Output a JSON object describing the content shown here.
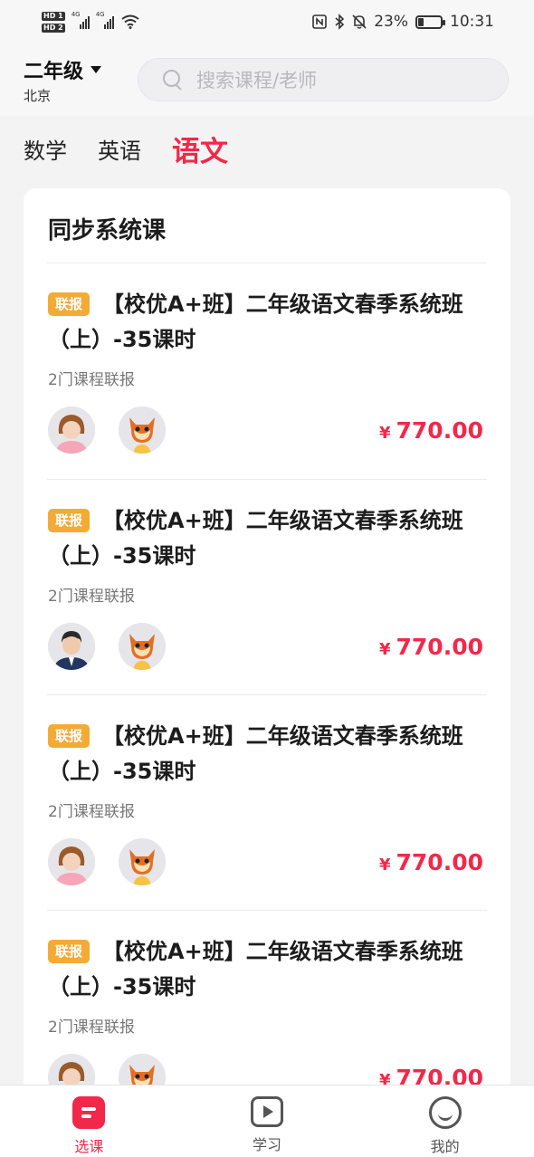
{
  "status_bar": {
    "sim1": "HD 1",
    "sim2": "HD 2",
    "net1": "4G",
    "net2": "4G",
    "battery_text": "23%",
    "battery_level": 0.23,
    "time": "10:31"
  },
  "header": {
    "grade": "二年级",
    "city": "北京",
    "search_placeholder": "搜索课程/老师"
  },
  "tabs": [
    {
      "label": "数学",
      "active": false
    },
    {
      "label": "英语",
      "active": false
    },
    {
      "label": "语文",
      "active": true
    }
  ],
  "section": {
    "title": "同步系统课",
    "courses": [
      {
        "tag": "联报",
        "title": "【校优A+班】二年级语文春季系统班（上）-35课时",
        "subtitle": "2门课程联报",
        "price": "770.00",
        "currency": "¥",
        "teacher1": "female-teacher-avatar"
      },
      {
        "tag": "联报",
        "title": "【校优A+班】二年级语文春季系统班（上）-35课时",
        "subtitle": "2门课程联报",
        "price": "770.00",
        "currency": "¥",
        "teacher1": "male-teacher-avatar"
      },
      {
        "tag": "联报",
        "title": "【校优A+班】二年级语文春季系统班（上）-35课时",
        "subtitle": "2门课程联报",
        "price": "770.00",
        "currency": "¥",
        "teacher1": "female-teacher-avatar"
      },
      {
        "tag": "联报",
        "title": "【校优A+班】二年级语文春季系统班（上）-35课时",
        "subtitle": "2门课程联报",
        "price": "770.00",
        "currency": "¥",
        "teacher1": "female-teacher-avatar"
      }
    ]
  },
  "bottom_nav": [
    {
      "label": "选课",
      "active": true
    },
    {
      "label": "学习",
      "active": false
    },
    {
      "label": "我的",
      "active": false
    }
  ],
  "colors": {
    "accent": "#f2284a",
    "tag": "#f3ab35"
  }
}
